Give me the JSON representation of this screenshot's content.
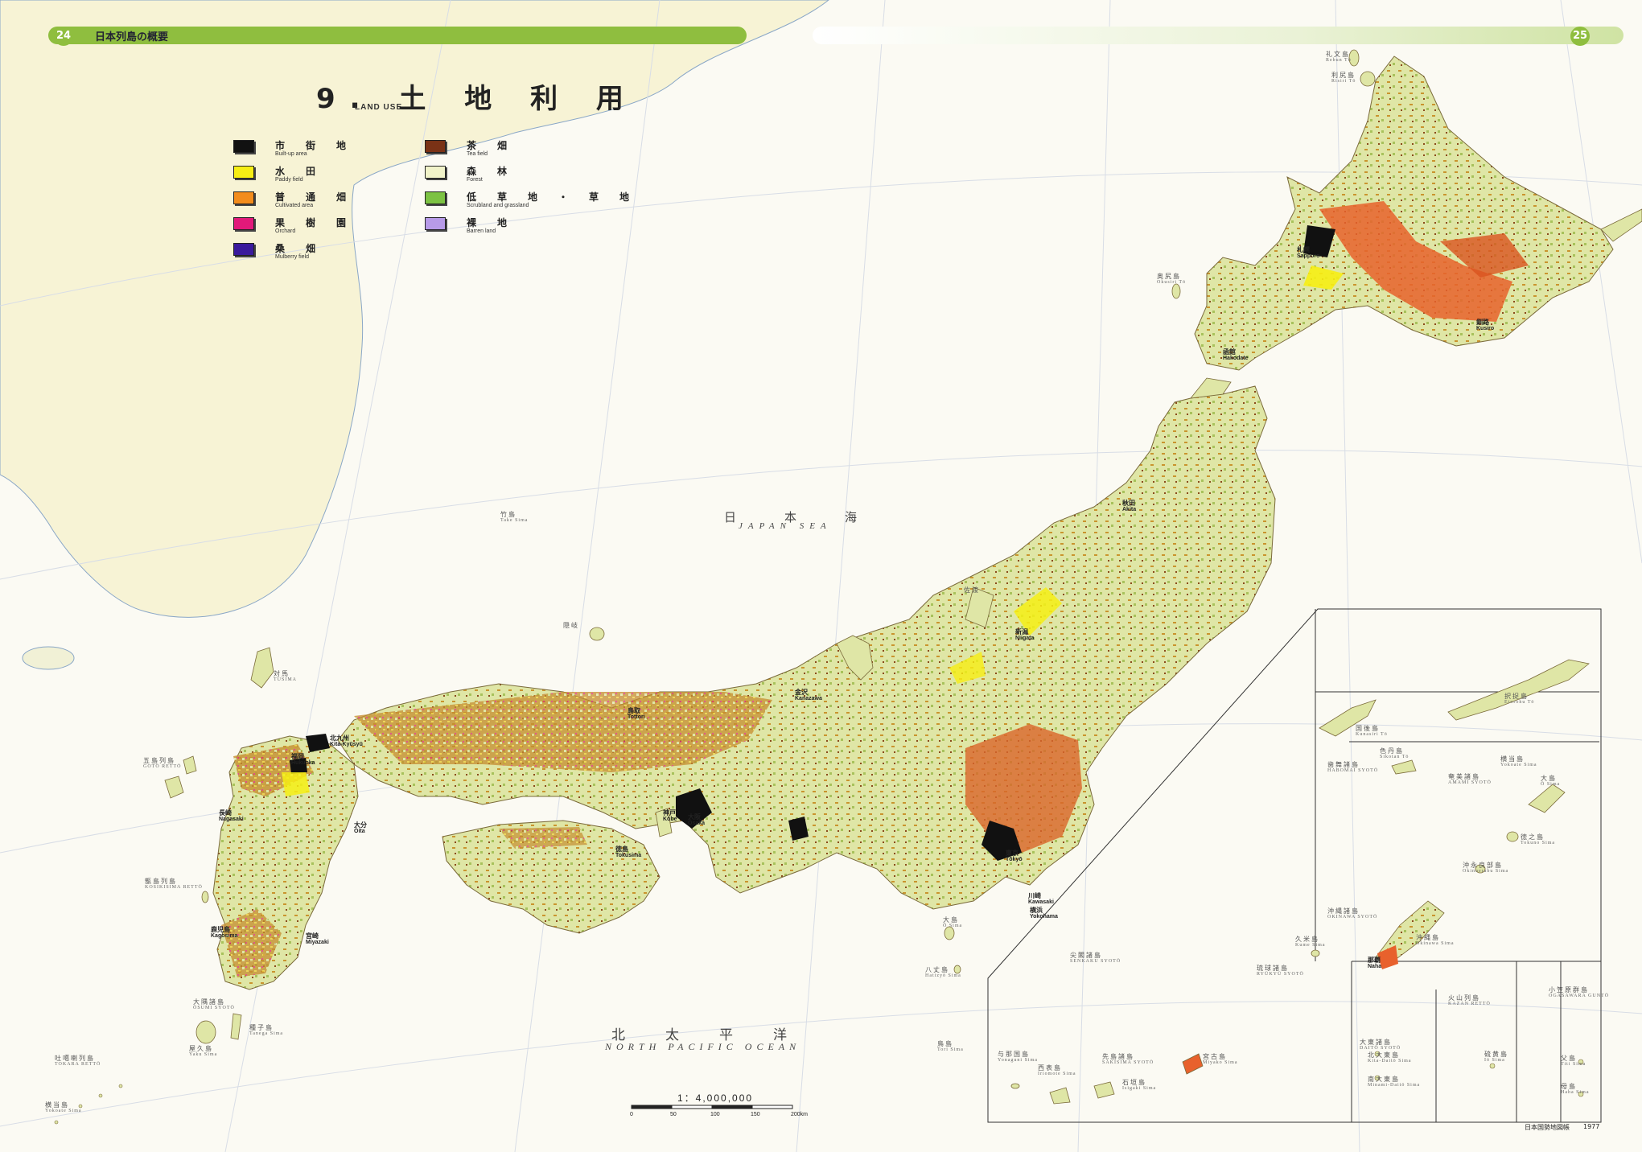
{
  "header": {
    "left_page_number": "24",
    "right_page_number": "25",
    "section_title": "日本列島の概要",
    "bar_color": "#8fbe3f"
  },
  "title": {
    "main": "9. 土 地 利 用",
    "sub": "LAND USE"
  },
  "legend": [
    {
      "jp": "市街地",
      "en": "Built-up area",
      "color": "#111111"
    },
    {
      "jp": "水田",
      "en": "Paddy field",
      "color": "#f6ee14"
    },
    {
      "jp": "普通畑",
      "en": "Cultivated area",
      "color": "#f28c1c"
    },
    {
      "jp": "果樹園",
      "en": "Orchard",
      "color": "#e2197a"
    },
    {
      "jp": "桑畑",
      "en": "Mulberry field",
      "color": "#3a1a9c"
    },
    {
      "jp": "茶畑",
      "en": "Tea field",
      "color": "#7a3216"
    },
    {
      "jp": "森林",
      "en": "Forest",
      "color": "#f1f3c9"
    },
    {
      "jp": "低草地・草地",
      "en": "Scrubland and grassland",
      "color": "#7cc243"
    },
    {
      "jp": "裸地",
      "en": "Barren land",
      "color": "#b79ae8"
    }
  ],
  "seas": {
    "japan_sea_jp": "日本海",
    "japan_sea_en": "JAPAN SEA",
    "pacific_jp": "北太平洋",
    "pacific_en": "NORTH PACIFIC OCEAN"
  },
  "cities": [
    {
      "jp": "札幌",
      "en": "Sapporo"
    },
    {
      "jp": "函館",
      "en": "Hakodate"
    },
    {
      "jp": "釧路",
      "en": "Kusiro"
    },
    {
      "jp": "秋田",
      "en": "Akita"
    },
    {
      "jp": "新潟",
      "en": "Niigata"
    },
    {
      "jp": "金沢",
      "en": "Kanazawa"
    },
    {
      "jp": "鳥取",
      "en": "Tottori"
    },
    {
      "jp": "東京",
      "en": "Tōkyō"
    },
    {
      "jp": "川崎",
      "en": "Kawasaki"
    },
    {
      "jp": "横浜",
      "en": "Yokohama"
    },
    {
      "jp": "大阪",
      "en": "Ōsaka"
    },
    {
      "jp": "神戸",
      "en": "Kōbe"
    },
    {
      "jp": "徳島",
      "en": "Tokusima"
    },
    {
      "jp": "北九州",
      "en": "Kita-Kyūsyū"
    },
    {
      "jp": "福岡",
      "en": "Hukuoka"
    },
    {
      "jp": "長崎",
      "en": "Nagasaki"
    },
    {
      "jp": "大分",
      "en": "Ōita"
    },
    {
      "jp": "宮崎",
      "en": "Miyazaki"
    },
    {
      "jp": "鹿児島",
      "en": "Kagosima"
    },
    {
      "jp": "那覇",
      "en": "Naha"
    }
  ],
  "islands": [
    {
      "jp": "礼文島",
      "en": "Rebun Tō"
    },
    {
      "jp": "利尻島",
      "en": "Risiri Tō"
    },
    {
      "jp": "奥尻島",
      "en": "Okusiri Tō"
    },
    {
      "jp": "佐渡",
      "en": ""
    },
    {
      "jp": "隠岐",
      "en": ""
    },
    {
      "jp": "対馬",
      "en": "TUSIMA"
    },
    {
      "jp": "竹島",
      "en": "Take Sima"
    },
    {
      "jp": "五島列島",
      "en": "GOTŌ RETTŌ"
    },
    {
      "jp": "甑島列島",
      "en": "KOSIKISIMA RETTŌ"
    },
    {
      "jp": "大隅諸島",
      "en": "ŌSUMI SYOTŌ"
    },
    {
      "jp": "種子島",
      "en": "Tanega Sima"
    },
    {
      "jp": "屋久島",
      "en": "Yaku Sima"
    },
    {
      "jp": "吐噶喇列島",
      "en": "TOKARA RETTŌ"
    },
    {
      "jp": "横当島",
      "en": "Yokoate Sima"
    },
    {
      "jp": "大島",
      "en": "Ō Sima"
    },
    {
      "jp": "八丈島",
      "en": "Hatizyō Sima"
    },
    {
      "jp": "鳥島",
      "en": "Tori Sima"
    }
  ],
  "inset_labels": [
    {
      "jp": "択捉島",
      "en": "Etorohu Tō"
    },
    {
      "jp": "国後島",
      "en": "Kunasiri Tō"
    },
    {
      "jp": "歯舞諸島",
      "en": "HABOMAI SYOTŌ"
    },
    {
      "jp": "色丹島",
      "en": "Sikotan Tō"
    },
    {
      "jp": "横当島",
      "en": "Yokoate Sima"
    },
    {
      "jp": "奄美諸島",
      "en": "AMAMI SYOTŌ"
    },
    {
      "jp": "大島",
      "en": "Ō Sima"
    },
    {
      "jp": "徳之島",
      "en": "Tokuno Sima"
    },
    {
      "jp": "沖永良部島",
      "en": "Okinoerabu Sima"
    },
    {
      "jp": "沖縄諸島",
      "en": "OKINAWA SYOTŌ"
    },
    {
      "jp": "久米島",
      "en": "Kume Sima"
    },
    {
      "jp": "沖縄島",
      "en": "Okinawa Sima"
    },
    {
      "jp": "琉球諸島",
      "en": "RYŪKYŪ SYOTŌ"
    },
    {
      "jp": "尖閣諸島",
      "en": "SENKAKU SYOTŌ"
    },
    {
      "jp": "先島諸島",
      "en": "SAKISIMA SYOTŌ"
    },
    {
      "jp": "宮古島",
      "en": "Miyako Sima"
    },
    {
      "jp": "石垣島",
      "en": "Isigaki Sima"
    },
    {
      "jp": "西表島",
      "en": "Iriomote Sima"
    },
    {
      "jp": "与那国島",
      "en": "Yonaguni Sima"
    },
    {
      "jp": "大東諸島",
      "en": "DAITŌ SYOTŌ"
    },
    {
      "jp": "北大東島",
      "en": "Kita-Daitō Sima"
    },
    {
      "jp": "南大東島",
      "en": "Minami-Daitō Sima"
    },
    {
      "jp": "火山列島",
      "en": "KAZAN RETTŌ"
    },
    {
      "jp": "硫黄島",
      "en": "Iō Sima"
    },
    {
      "jp": "小笠原群島",
      "en": "OGASAWARA GUNTŌ"
    },
    {
      "jp": "父島",
      "en": "Titi Sima"
    },
    {
      "jp": "母島",
      "en": "Haha Sima"
    }
  ],
  "scale": {
    "ratio": "1：4,000,000",
    "ticks": [
      "0",
      "50",
      "100",
      "150",
      "200km"
    ]
  },
  "footer": {
    "publisher": "日本国勢地図帳",
    "year": "1977"
  }
}
